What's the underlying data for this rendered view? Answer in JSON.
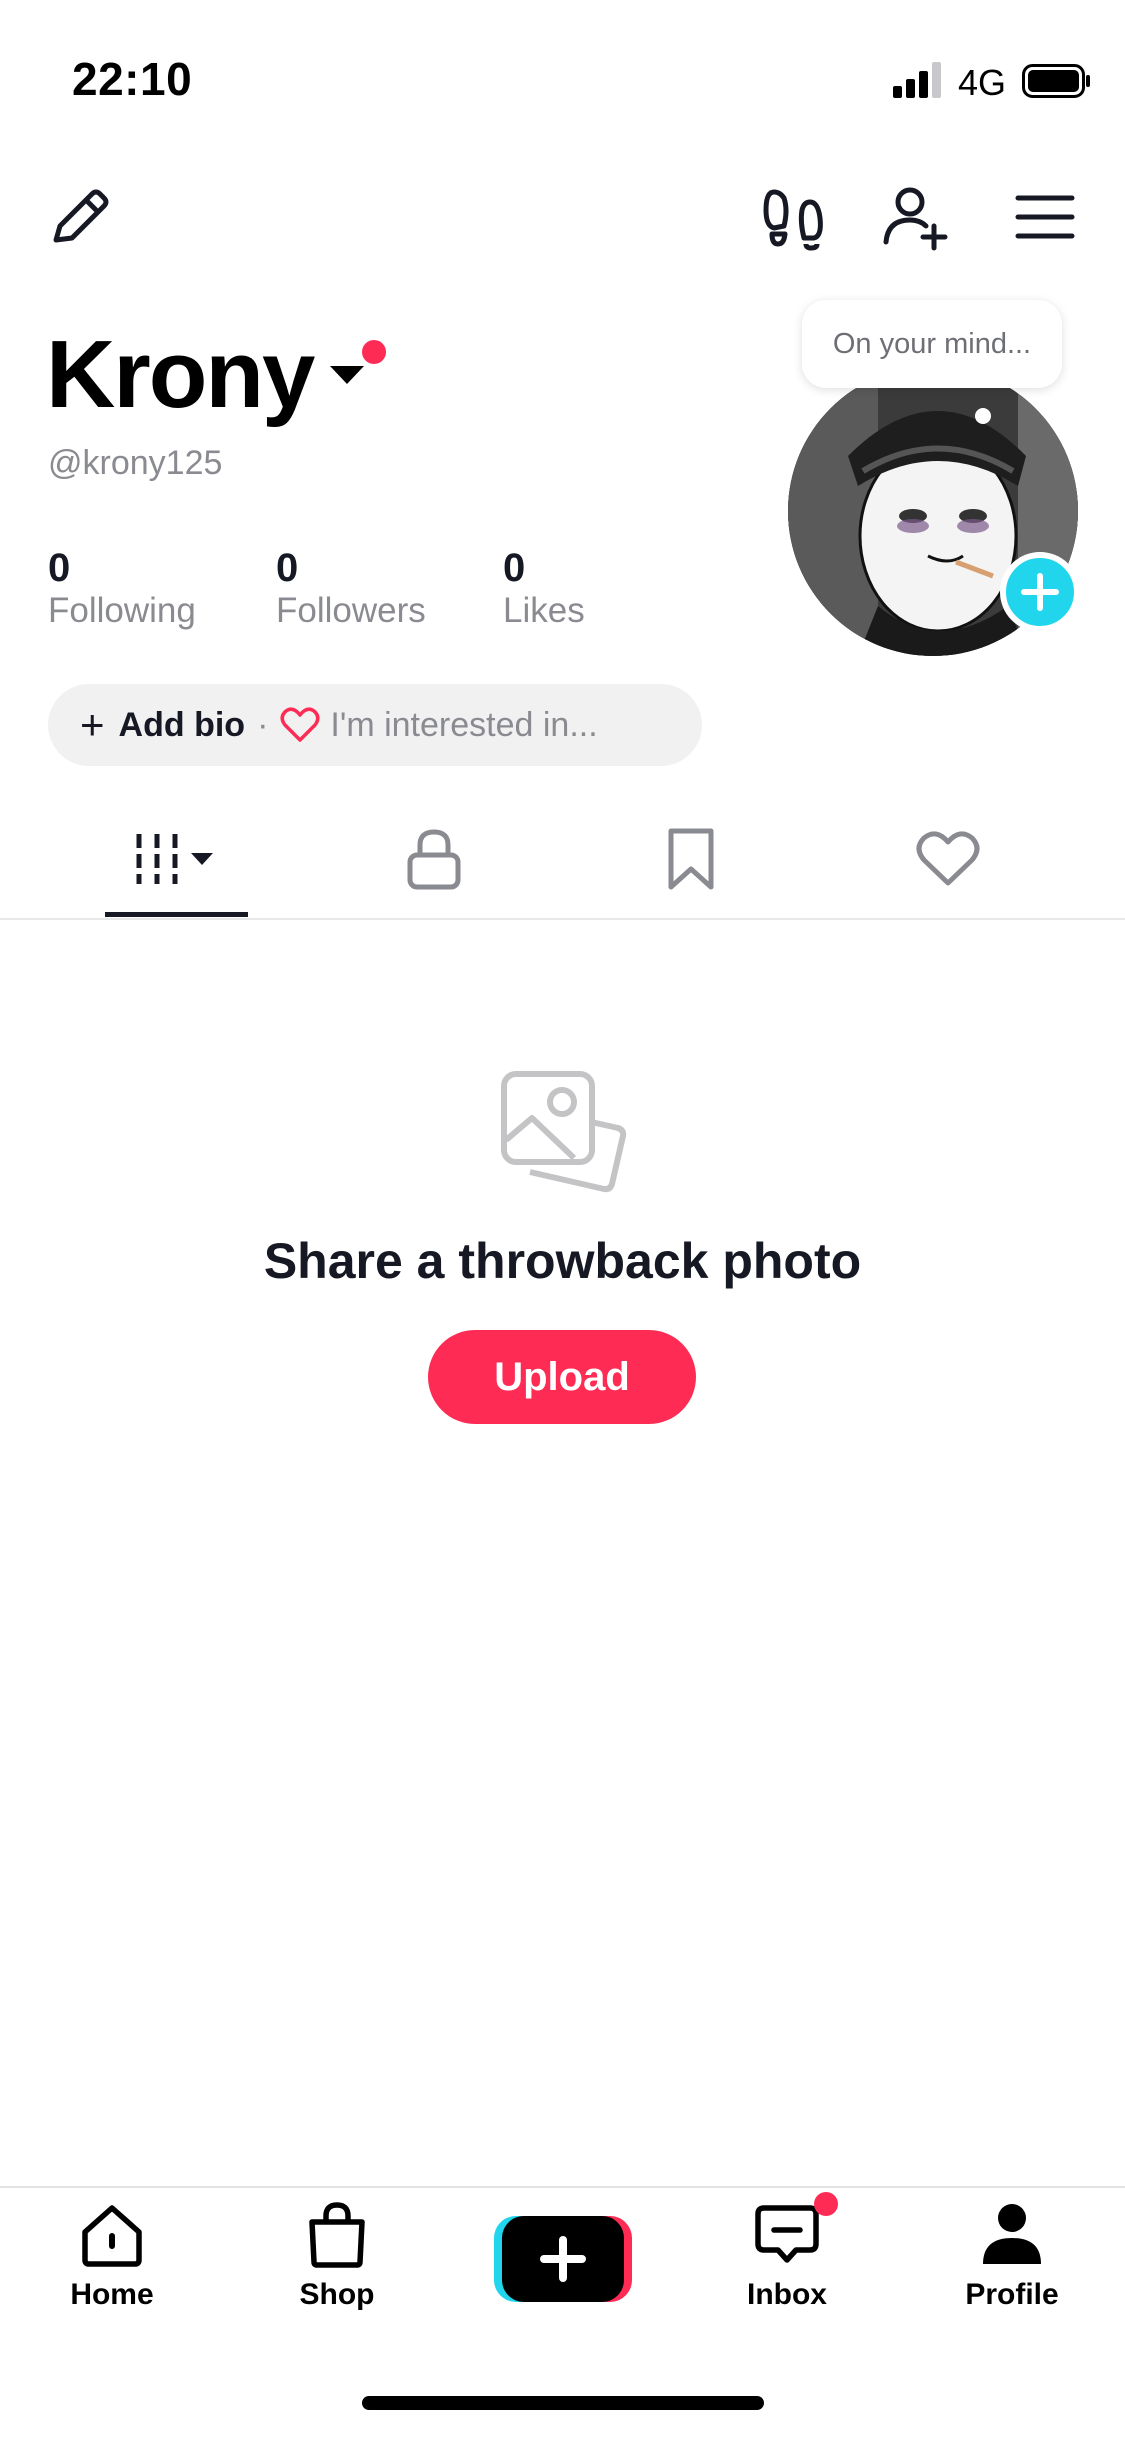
{
  "status_bar": {
    "time": "22:10",
    "network": "4G"
  },
  "top_nav": {
    "icons": [
      "edit-icon",
      "footprints-icon",
      "add-friend-icon",
      "menu-icon"
    ]
  },
  "profile": {
    "name": "Krony",
    "handle": "@krony125",
    "thought_bubble": "On your mind...",
    "stats": [
      {
        "value": "0",
        "label": "Following"
      },
      {
        "value": "0",
        "label": "Followers"
      },
      {
        "value": "0",
        "label": "Likes"
      }
    ],
    "bio": {
      "add_label": "Add bio",
      "separator": "·",
      "interest_label": "I'm interested in..."
    }
  },
  "content_tabs": [
    {
      "icon": "grid-icon",
      "selected": true
    },
    {
      "icon": "lock-icon",
      "selected": false
    },
    {
      "icon": "bookmark-icon",
      "selected": false
    },
    {
      "icon": "heart-icon",
      "selected": false
    }
  ],
  "empty_state": {
    "title": "Share a throwback photo",
    "button": "Upload"
  },
  "bottom_nav": [
    {
      "label": "Home",
      "icon": "home-icon"
    },
    {
      "label": "Shop",
      "icon": "shop-bag-icon"
    },
    {
      "label": "",
      "icon": "create-plus-icon"
    },
    {
      "label": "Inbox",
      "icon": "inbox-icon"
    },
    {
      "label": "Profile",
      "icon": "profile-icon"
    }
  ],
  "colors": {
    "accent": "#fe2c55",
    "cyan": "#20d5ec",
    "text": "#161823",
    "muted": "#8a8b91"
  }
}
